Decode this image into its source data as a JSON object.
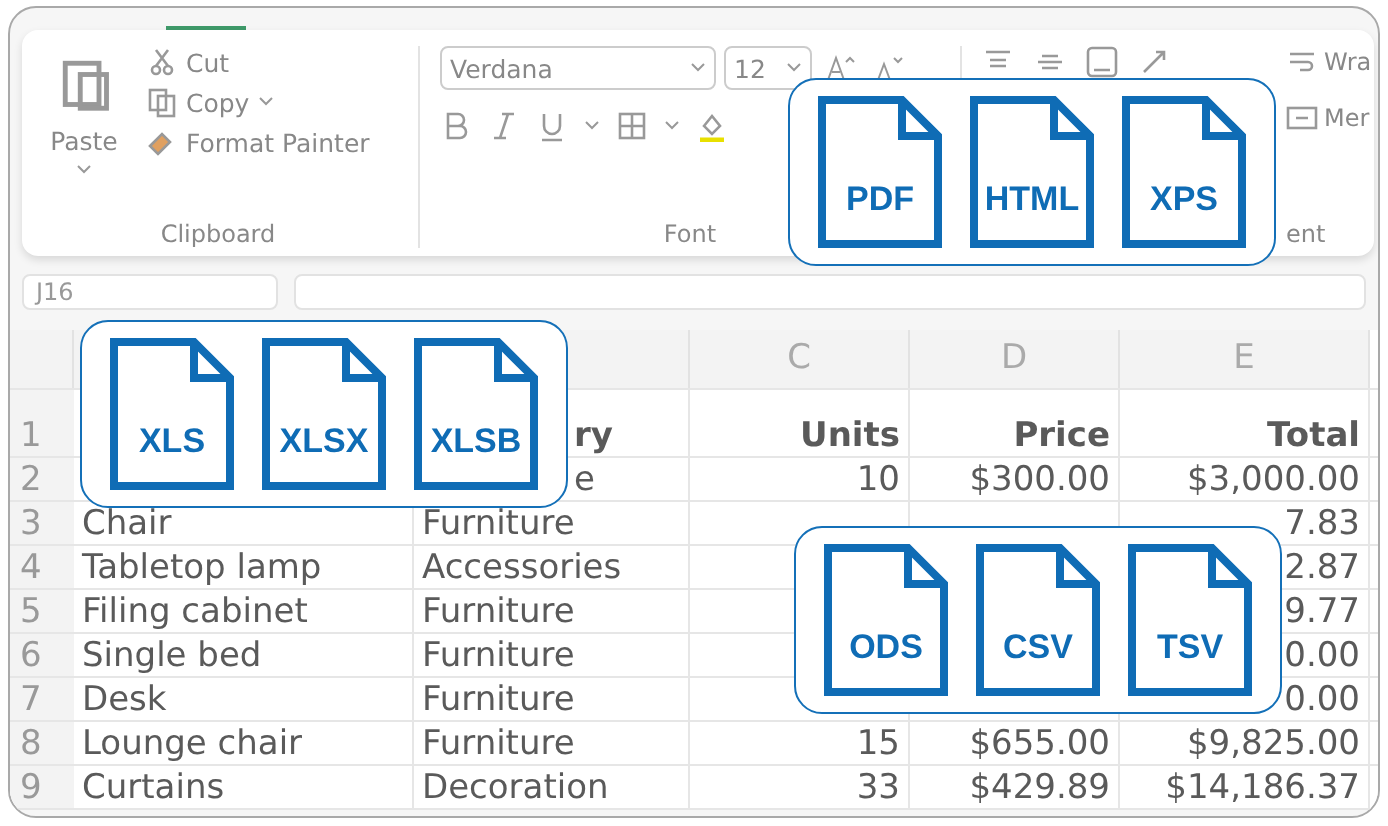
{
  "ribbon": {
    "clipboard": {
      "paste": "Paste",
      "cut": "Cut",
      "copy": "Copy",
      "format_painter": "Format Painter",
      "label": "Clipboard"
    },
    "font": {
      "name": "Verdana",
      "size": "12",
      "label": "Font"
    },
    "alignment": {
      "wrap": "Wra",
      "merge": "Mer",
      "label": "ent"
    }
  },
  "formula_bar": {
    "name_box": "J16"
  },
  "column_headers": [
    "C",
    "D",
    "E"
  ],
  "rows": [
    {
      "number": "1",
      "kind": "header",
      "cells": {
        "B": {
          "text": "ry",
          "partial": true
        },
        "C": "Units",
        "D": "Price",
        "E": "Total"
      }
    },
    {
      "number": "2",
      "kind": "data",
      "cells": {
        "B": {
          "text": "e",
          "partial": true
        },
        "C": "10",
        "D": "$300.00",
        "E": "$3,000.00"
      }
    },
    {
      "number": "3",
      "kind": "data",
      "cells": {
        "A": "Chair",
        "B": "Furniture",
        "E": "7.83"
      }
    },
    {
      "number": "4",
      "kind": "data",
      "cells": {
        "A": "Tabletop lamp",
        "B": "Accessories",
        "E": "2.87"
      }
    },
    {
      "number": "5",
      "kind": "data",
      "cells": {
        "A": "Filing cabinet",
        "B": "Furniture",
        "E": "9.77"
      }
    },
    {
      "number": "6",
      "kind": "data",
      "cells": {
        "A": "Single bed",
        "B": "Furniture",
        "E": "0.00"
      }
    },
    {
      "number": "7",
      "kind": "data",
      "cells": {
        "A": "Desk",
        "B": "Furniture",
        "E": "0.00"
      }
    },
    {
      "number": "8",
      "kind": "data",
      "cells": {
        "A": "Lounge chair",
        "B": "Furniture",
        "C": "15",
        "D": "$655.00",
        "E": "$9,825.00"
      }
    },
    {
      "number": "9",
      "kind": "data",
      "cells": {
        "A": "Curtains",
        "B": "Decoration",
        "C": "33",
        "D": "$429.89",
        "E": "$14,186.37"
      }
    }
  ],
  "format_cards": [
    {
      "formats": [
        "PDF",
        "HTML",
        "XPS"
      ]
    },
    {
      "formats": [
        "XLS",
        "XLSX",
        "XLSB"
      ]
    },
    {
      "formats": [
        "ODS",
        "CSV",
        "TSV"
      ]
    }
  ]
}
